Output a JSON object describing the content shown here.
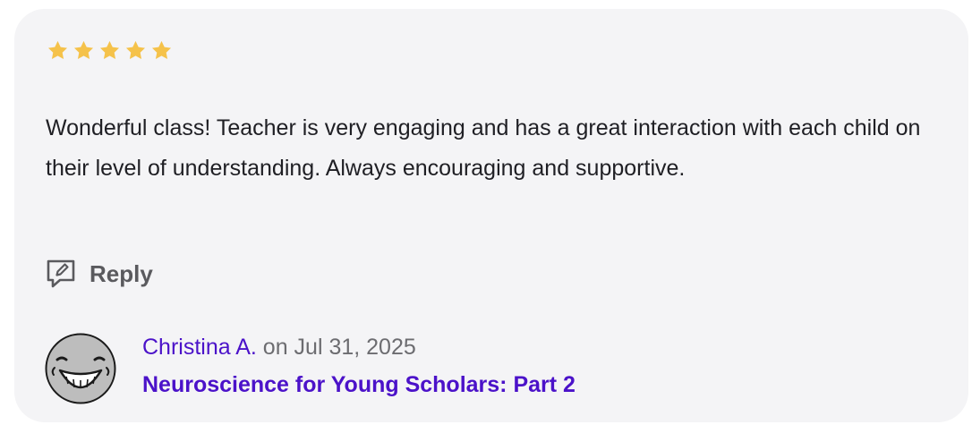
{
  "review": {
    "rating": 5,
    "rating_max": 5,
    "star_color": "#f5c24a",
    "text": "Wonderful class! Teacher is very engaging and has a great interaction with each child on their level of understanding. Always encouraging and supportive.",
    "reply_label": "Reply",
    "reply_icon": "reply-chat-icon",
    "author": "Christina A.",
    "date_text": "on Jul 31, 2025",
    "course": "Neuroscience for Young Scholars: Part 2",
    "avatar_icon": "grinning-face-icon"
  },
  "colors": {
    "accent": "#4b12c9",
    "card_bg": "#f4f4f6",
    "text": "#1f1f24",
    "muted": "#6c6c70"
  }
}
